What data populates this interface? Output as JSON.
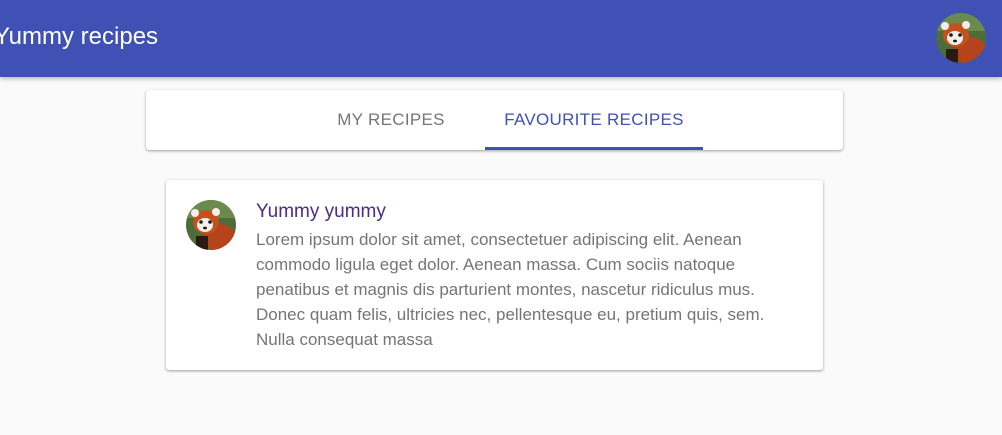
{
  "app_bar": {
    "title": "Yummy recipes",
    "background": "#3f51b5",
    "user_avatar_icon": "red-panda-avatar"
  },
  "tabs": {
    "items": [
      {
        "label": "MY RECIPES",
        "selected": false
      },
      {
        "label": "FAVOURITE RECIPES",
        "selected": true
      }
    ],
    "accent": "#3f51b5"
  },
  "recipes": [
    {
      "avatar_icon": "red-panda-avatar",
      "title": "Yummy yummy",
      "description": "Lorem ipsum dolor sit amet, consectetuer adipiscing elit. Aenean commodo ligula eget dolor. Aenean massa. Cum sociis natoque penatibus et magnis dis parturient montes, nascetur ridiculus mus. Donec quam felis, ultricies nec, pellentesque eu, pretium quis, sem. Nulla consequat massa"
    }
  ]
}
